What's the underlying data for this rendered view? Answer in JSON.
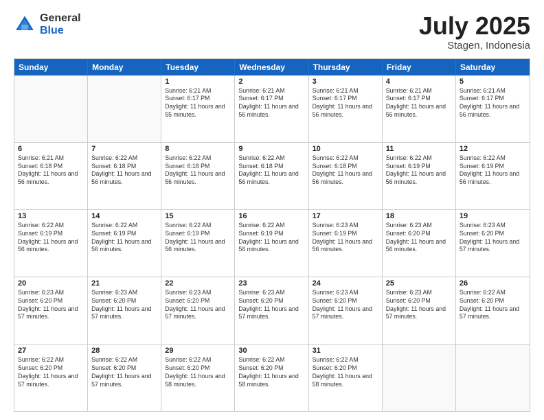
{
  "header": {
    "logo": {
      "general": "General",
      "blue": "Blue"
    },
    "title": "July 2025",
    "location": "Stagen, Indonesia"
  },
  "days_of_week": [
    "Sunday",
    "Monday",
    "Tuesday",
    "Wednesday",
    "Thursday",
    "Friday",
    "Saturday"
  ],
  "weeks": [
    [
      {
        "day": "",
        "sunrise": "",
        "sunset": "",
        "daylight": ""
      },
      {
        "day": "",
        "sunrise": "",
        "sunset": "",
        "daylight": ""
      },
      {
        "day": "1",
        "sunrise": "Sunrise: 6:21 AM",
        "sunset": "Sunset: 6:17 PM",
        "daylight": "Daylight: 11 hours and 55 minutes."
      },
      {
        "day": "2",
        "sunrise": "Sunrise: 6:21 AM",
        "sunset": "Sunset: 6:17 PM",
        "daylight": "Daylight: 11 hours and 56 minutes."
      },
      {
        "day": "3",
        "sunrise": "Sunrise: 6:21 AM",
        "sunset": "Sunset: 6:17 PM",
        "daylight": "Daylight: 11 hours and 56 minutes."
      },
      {
        "day": "4",
        "sunrise": "Sunrise: 6:21 AM",
        "sunset": "Sunset: 6:17 PM",
        "daylight": "Daylight: 11 hours and 56 minutes."
      },
      {
        "day": "5",
        "sunrise": "Sunrise: 6:21 AM",
        "sunset": "Sunset: 6:17 PM",
        "daylight": "Daylight: 11 hours and 56 minutes."
      }
    ],
    [
      {
        "day": "6",
        "sunrise": "Sunrise: 6:21 AM",
        "sunset": "Sunset: 6:18 PM",
        "daylight": "Daylight: 11 hours and 56 minutes."
      },
      {
        "day": "7",
        "sunrise": "Sunrise: 6:22 AM",
        "sunset": "Sunset: 6:18 PM",
        "daylight": "Daylight: 11 hours and 56 minutes."
      },
      {
        "day": "8",
        "sunrise": "Sunrise: 6:22 AM",
        "sunset": "Sunset: 6:18 PM",
        "daylight": "Daylight: 11 hours and 56 minutes."
      },
      {
        "day": "9",
        "sunrise": "Sunrise: 6:22 AM",
        "sunset": "Sunset: 6:18 PM",
        "daylight": "Daylight: 11 hours and 56 minutes."
      },
      {
        "day": "10",
        "sunrise": "Sunrise: 6:22 AM",
        "sunset": "Sunset: 6:18 PM",
        "daylight": "Daylight: 11 hours and 56 minutes."
      },
      {
        "day": "11",
        "sunrise": "Sunrise: 6:22 AM",
        "sunset": "Sunset: 6:19 PM",
        "daylight": "Daylight: 11 hours and 56 minutes."
      },
      {
        "day": "12",
        "sunrise": "Sunrise: 6:22 AM",
        "sunset": "Sunset: 6:19 PM",
        "daylight": "Daylight: 11 hours and 56 minutes."
      }
    ],
    [
      {
        "day": "13",
        "sunrise": "Sunrise: 6:22 AM",
        "sunset": "Sunset: 6:19 PM",
        "daylight": "Daylight: 11 hours and 56 minutes."
      },
      {
        "day": "14",
        "sunrise": "Sunrise: 6:22 AM",
        "sunset": "Sunset: 6:19 PM",
        "daylight": "Daylight: 11 hours and 56 minutes."
      },
      {
        "day": "15",
        "sunrise": "Sunrise: 6:22 AM",
        "sunset": "Sunset: 6:19 PM",
        "daylight": "Daylight: 11 hours and 56 minutes."
      },
      {
        "day": "16",
        "sunrise": "Sunrise: 6:22 AM",
        "sunset": "Sunset: 6:19 PM",
        "daylight": "Daylight: 11 hours and 56 minutes."
      },
      {
        "day": "17",
        "sunrise": "Sunrise: 6:23 AM",
        "sunset": "Sunset: 6:19 PM",
        "daylight": "Daylight: 11 hours and 56 minutes."
      },
      {
        "day": "18",
        "sunrise": "Sunrise: 6:23 AM",
        "sunset": "Sunset: 6:20 PM",
        "daylight": "Daylight: 11 hours and 56 minutes."
      },
      {
        "day": "19",
        "sunrise": "Sunrise: 6:23 AM",
        "sunset": "Sunset: 6:20 PM",
        "daylight": "Daylight: 11 hours and 57 minutes."
      }
    ],
    [
      {
        "day": "20",
        "sunrise": "Sunrise: 6:23 AM",
        "sunset": "Sunset: 6:20 PM",
        "daylight": "Daylight: 11 hours and 57 minutes."
      },
      {
        "day": "21",
        "sunrise": "Sunrise: 6:23 AM",
        "sunset": "Sunset: 6:20 PM",
        "daylight": "Daylight: 11 hours and 57 minutes."
      },
      {
        "day": "22",
        "sunrise": "Sunrise: 6:23 AM",
        "sunset": "Sunset: 6:20 PM",
        "daylight": "Daylight: 11 hours and 57 minutes."
      },
      {
        "day": "23",
        "sunrise": "Sunrise: 6:23 AM",
        "sunset": "Sunset: 6:20 PM",
        "daylight": "Daylight: 11 hours and 57 minutes."
      },
      {
        "day": "24",
        "sunrise": "Sunrise: 6:23 AM",
        "sunset": "Sunset: 6:20 PM",
        "daylight": "Daylight: 11 hours and 57 minutes."
      },
      {
        "day": "25",
        "sunrise": "Sunrise: 6:23 AM",
        "sunset": "Sunset: 6:20 PM",
        "daylight": "Daylight: 11 hours and 57 minutes."
      },
      {
        "day": "26",
        "sunrise": "Sunrise: 6:22 AM",
        "sunset": "Sunset: 6:20 PM",
        "daylight": "Daylight: 11 hours and 57 minutes."
      }
    ],
    [
      {
        "day": "27",
        "sunrise": "Sunrise: 6:22 AM",
        "sunset": "Sunset: 6:20 PM",
        "daylight": "Daylight: 11 hours and 57 minutes."
      },
      {
        "day": "28",
        "sunrise": "Sunrise: 6:22 AM",
        "sunset": "Sunset: 6:20 PM",
        "daylight": "Daylight: 11 hours and 57 minutes."
      },
      {
        "day": "29",
        "sunrise": "Sunrise: 6:22 AM",
        "sunset": "Sunset: 6:20 PM",
        "daylight": "Daylight: 11 hours and 58 minutes."
      },
      {
        "day": "30",
        "sunrise": "Sunrise: 6:22 AM",
        "sunset": "Sunset: 6:20 PM",
        "daylight": "Daylight: 11 hours and 58 minutes."
      },
      {
        "day": "31",
        "sunrise": "Sunrise: 6:22 AM",
        "sunset": "Sunset: 6:20 PM",
        "daylight": "Daylight: 11 hours and 58 minutes."
      },
      {
        "day": "",
        "sunrise": "",
        "sunset": "",
        "daylight": ""
      },
      {
        "day": "",
        "sunrise": "",
        "sunset": "",
        "daylight": ""
      }
    ]
  ]
}
